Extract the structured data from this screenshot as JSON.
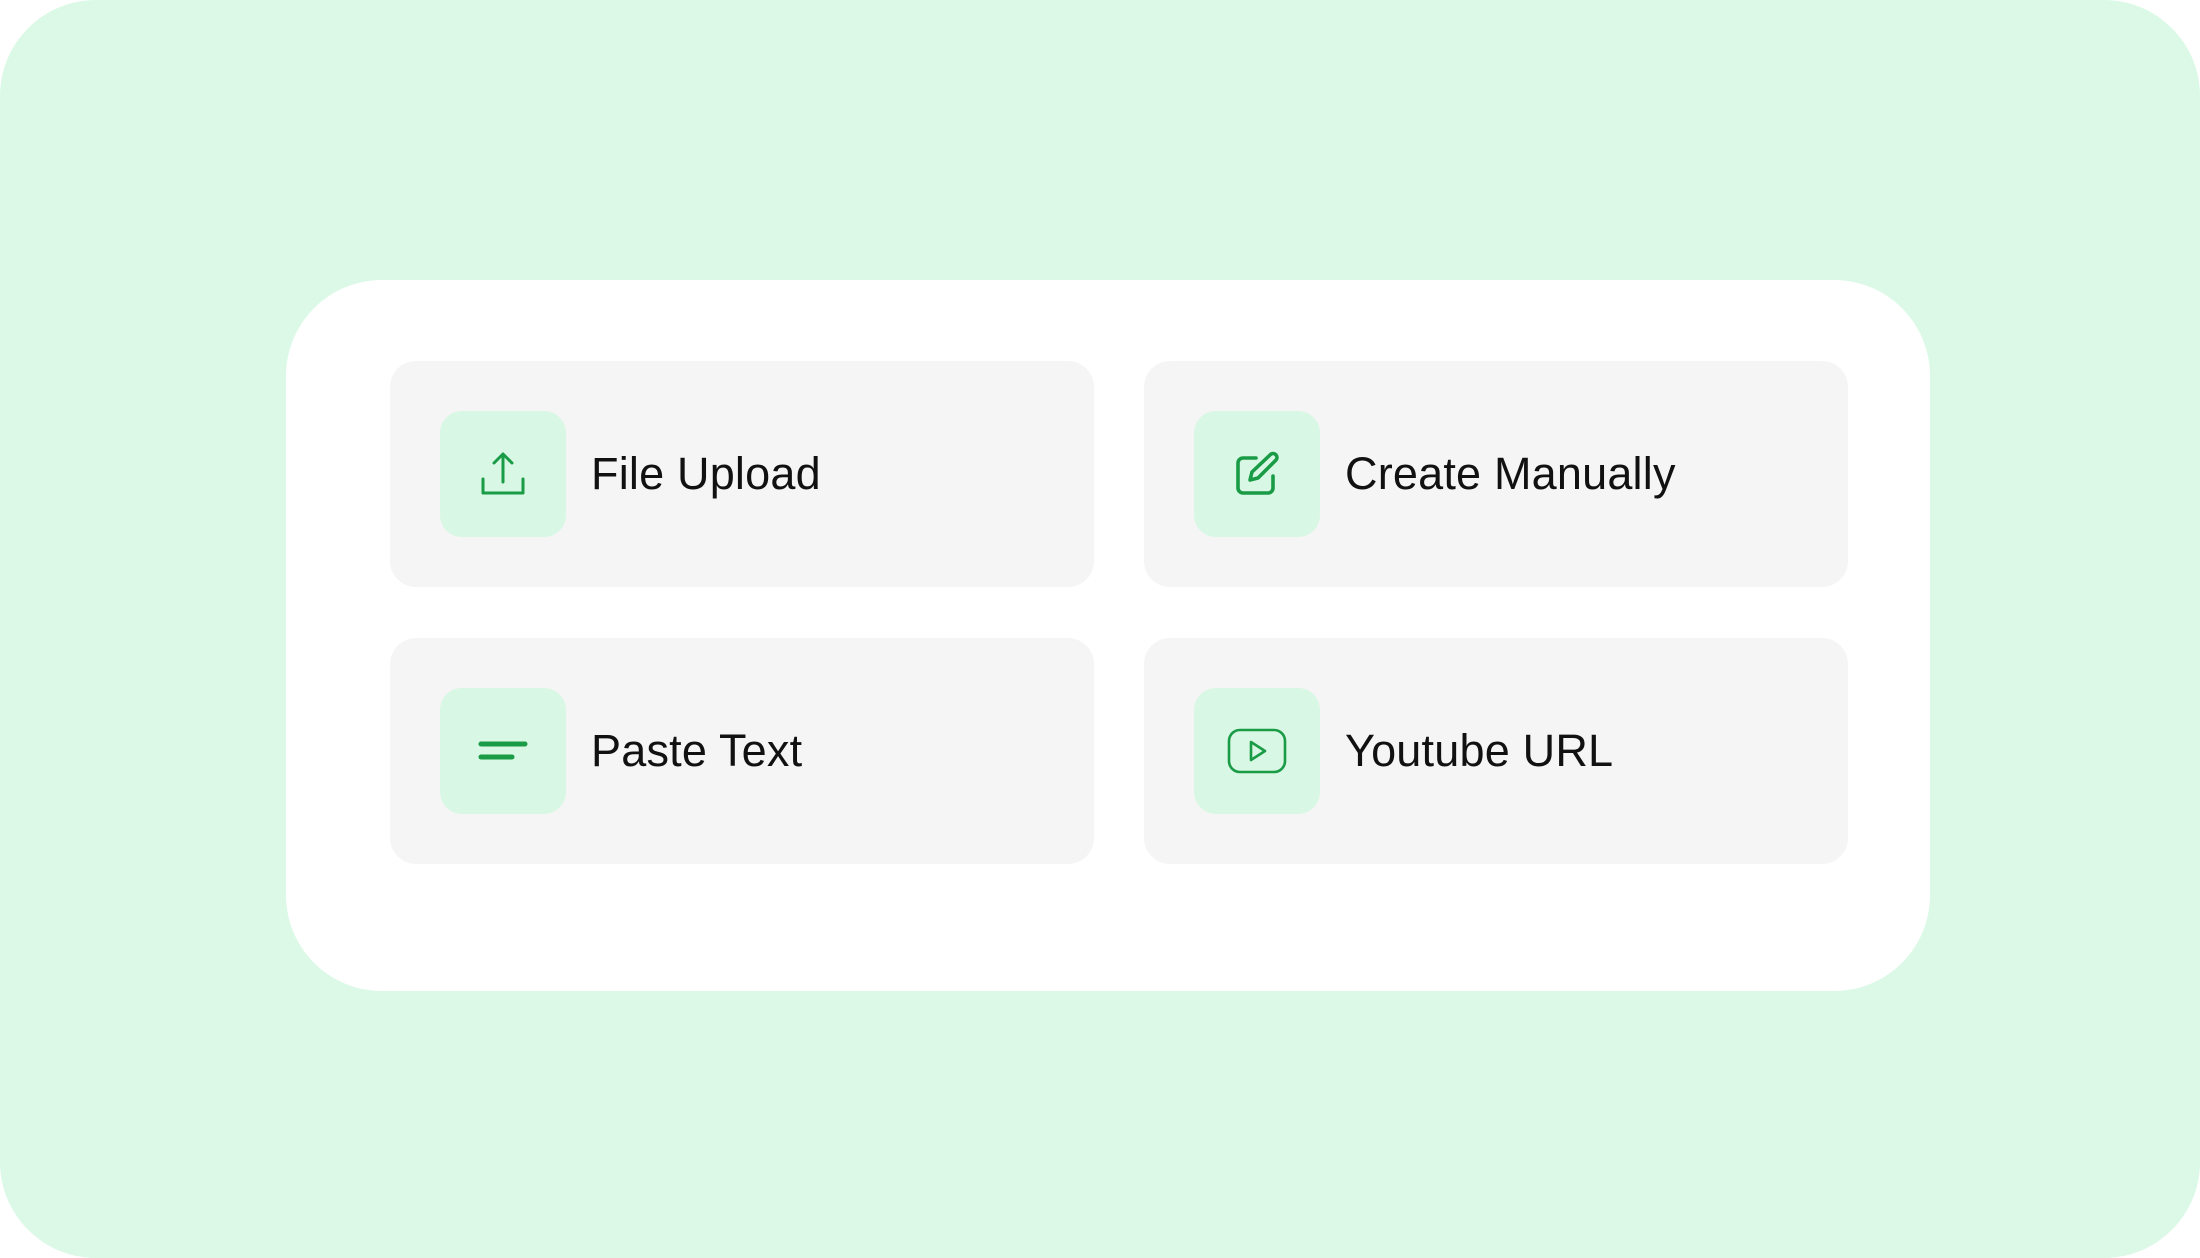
{
  "theme": {
    "backdrop_color": "#dcf9e7",
    "panel_color": "#ffffff",
    "card_color": "#f5f5f5",
    "icon_tile_color": "#d8f7e4",
    "accent_color": "#1a9b46"
  },
  "options": [
    {
      "label": "File Upload",
      "icon": "upload-icon"
    },
    {
      "label": "Create Manually",
      "icon": "edit-icon"
    },
    {
      "label": "Paste Text",
      "icon": "text-lines-icon"
    },
    {
      "label": "Youtube URL",
      "icon": "youtube-play-icon"
    }
  ]
}
